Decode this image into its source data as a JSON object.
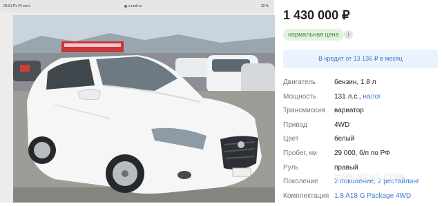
{
  "status_bar": {
    "time": "09:51",
    "date": "Пт 24 сент.",
    "url": "e.mail.ru",
    "battery": "18 %"
  },
  "listing": {
    "price": "1 430 000 ₽",
    "price_badge": "нормальная цена",
    "info_icon_glyph": "i",
    "credit": "В кредит от 13 136 ₽ в месяц",
    "specs": [
      {
        "label": "Двигатель",
        "value": "бензин, 1.8 л"
      },
      {
        "label": "Мощность",
        "value": "131 л.с., ",
        "link": "налог"
      },
      {
        "label": "Трансмиссия",
        "value": "вариатор"
      },
      {
        "label": "Привод",
        "value": "4WD"
      },
      {
        "label": "Цвет",
        "value": "белый"
      },
      {
        "label": "Пробег, км",
        "value": "29 000, б/п по РФ"
      },
      {
        "label": "Руль",
        "value": "правый"
      },
      {
        "label": "Поколение",
        "value": "2 поколение, 2 рестайлинг"
      },
      {
        "label": "Комплектация",
        "value": "",
        "link": "1.8 A18 G Package 4WD"
      }
    ]
  },
  "watermark": "YAPLAKAL.COM",
  "icons": {
    "lock": "lock-icon",
    "info": "info-icon",
    "car_photo": "car-photo"
  },
  "colors": {
    "badge_bg": "#e4f3e1",
    "badge_text": "#3c8d3c",
    "credit_bg": "#eaf3fd",
    "link": "#3d7ad4"
  }
}
